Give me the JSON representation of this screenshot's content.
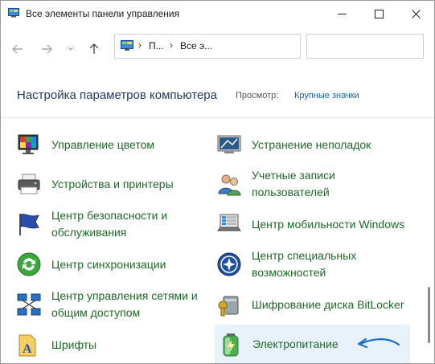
{
  "window": {
    "title": "Все элементы панели управления"
  },
  "navigation": {
    "breadcrumb": [
      "П...",
      "Все э..."
    ],
    "search_placeholder": ""
  },
  "header": {
    "title": "Настройка параметров компьютера",
    "view_label": "Просмотр:",
    "view_value": "Крупные значки"
  },
  "items": {
    "color_management": {
      "label": "Управление цветом",
      "icon": "color-management-icon"
    },
    "troubleshooting": {
      "label": "Устранение неполадок",
      "icon": "troubleshooting-icon"
    },
    "devices_printers": {
      "label": "Устройства и принтеры",
      "icon": "printer-icon"
    },
    "user_accounts": {
      "label": "Учетные записи пользователей",
      "icon": "users-icon"
    },
    "security_center": {
      "label": "Центр безопасности и обслуживания",
      "icon": "flag-icon"
    },
    "mobility_center": {
      "label": "Центр мобильности Windows",
      "icon": "mobility-icon"
    },
    "sync_center": {
      "label": "Центр синхронизации",
      "icon": "sync-icon"
    },
    "ease_of_access": {
      "label": "Центр специальных возможностей",
      "icon": "accessibility-icon"
    },
    "network_center": {
      "label": "Центр управления сетями и общим доступом",
      "icon": "network-icon"
    },
    "bitlocker": {
      "label": "Шифрование диска BitLocker",
      "icon": "bitlocker-icon"
    },
    "fonts": {
      "label": "Шрифты",
      "icon": "fonts-icon"
    },
    "power_options": {
      "label": "Электропитание",
      "icon": "battery-icon"
    }
  },
  "colors": {
    "link_green": "#1d6a26",
    "title_blue": "#1f3a6e",
    "link_blue": "#0a63b8",
    "highlight": "#e8f2fb",
    "arrow_blue": "#1a6fd1"
  }
}
